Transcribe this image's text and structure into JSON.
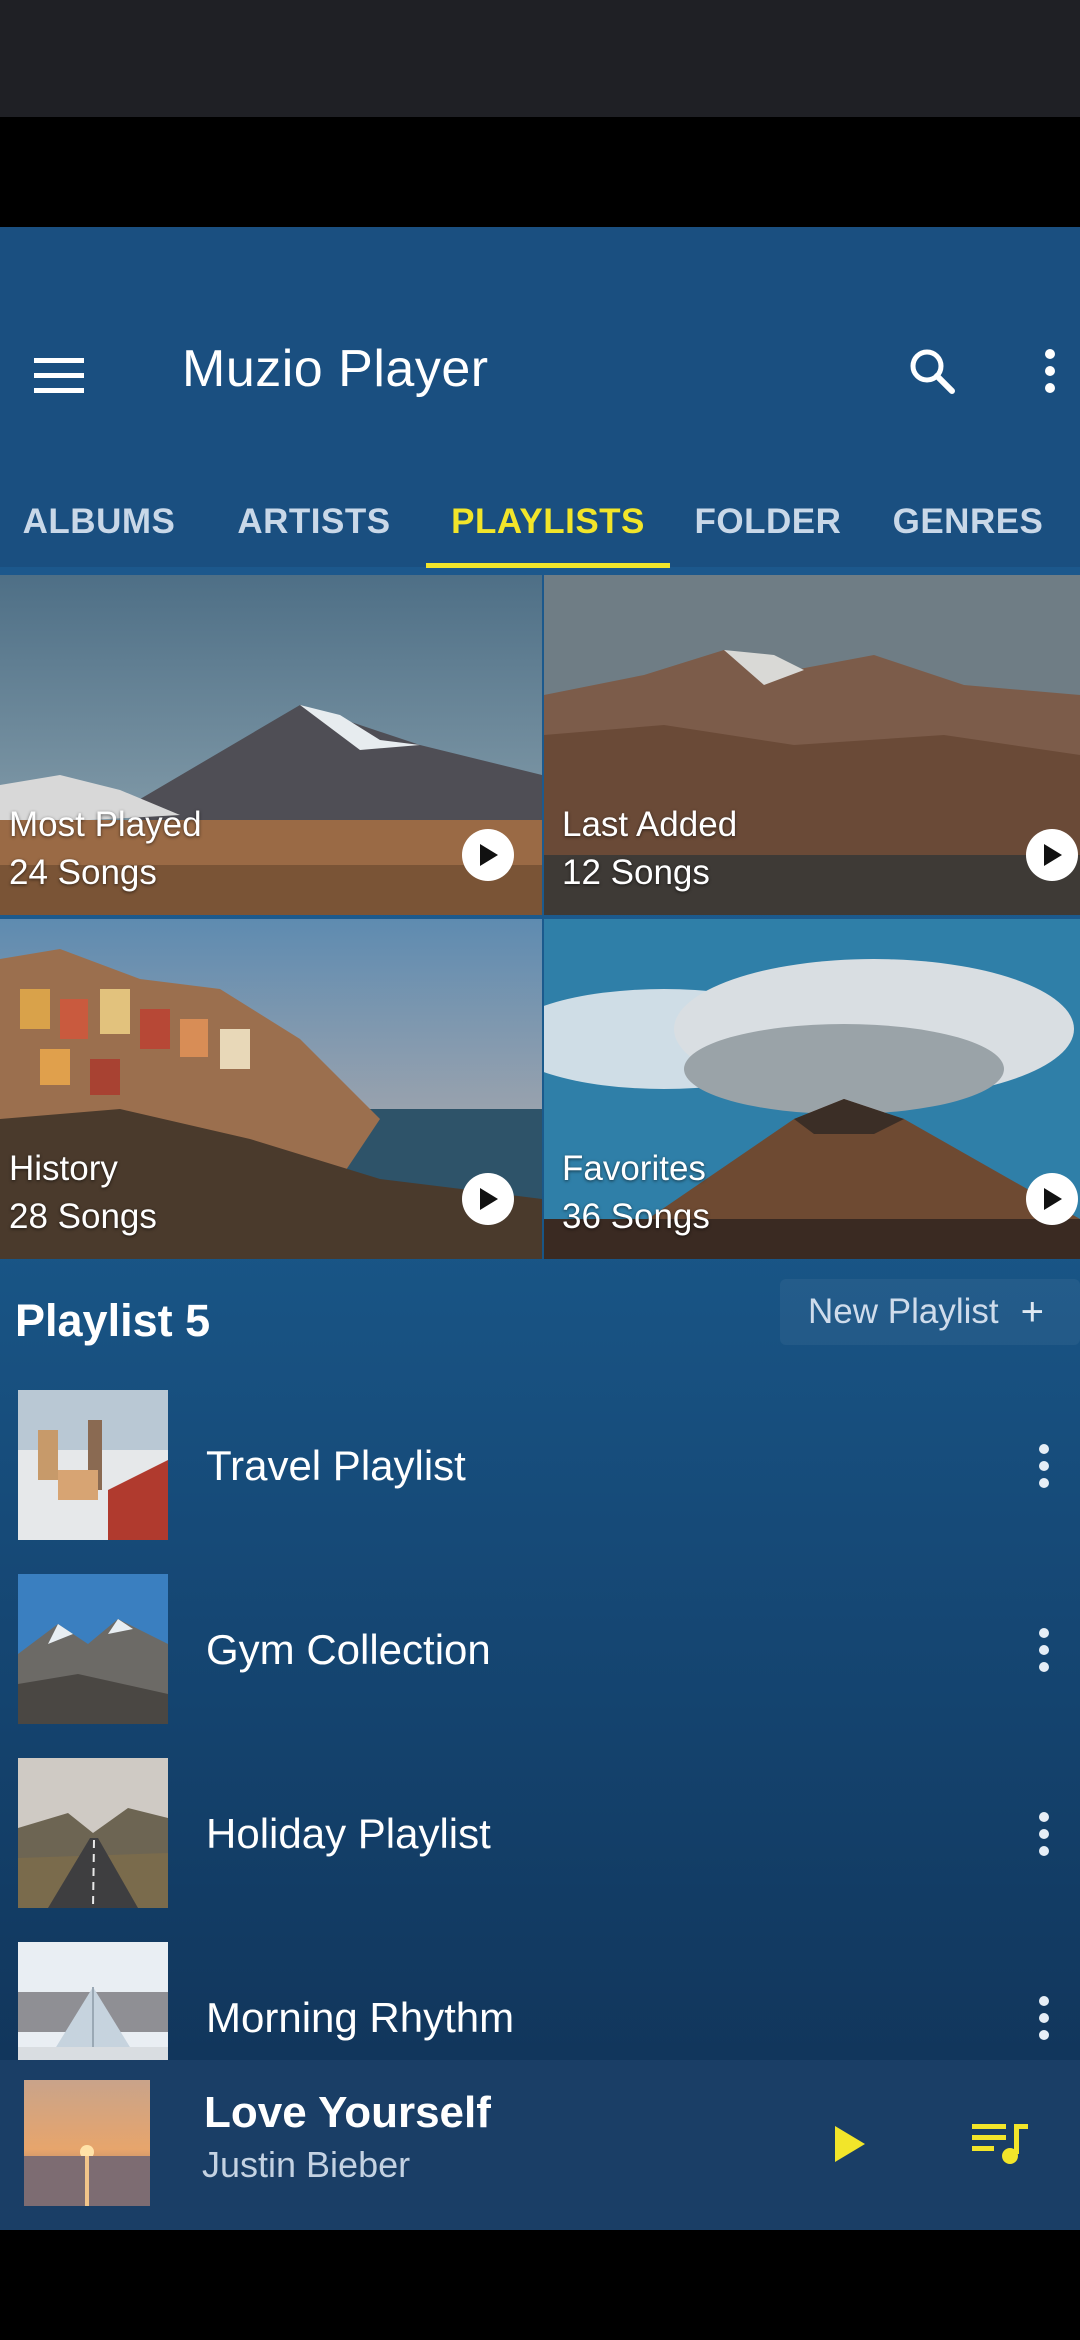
{
  "app": {
    "title": "Muzio Player"
  },
  "tabs": [
    {
      "label": "ALBUMS",
      "active": false
    },
    {
      "label": "ARTISTS",
      "active": false
    },
    {
      "label": "PLAYLISTS",
      "active": true
    },
    {
      "label": "FOLDER",
      "active": false
    },
    {
      "label": "GENRES",
      "active": false
    }
  ],
  "featured": [
    {
      "name": "Most Played",
      "count": "24 Songs"
    },
    {
      "name": "Last Added",
      "count": "12 Songs"
    },
    {
      "name": "History",
      "count": "28 Songs"
    },
    {
      "name": "Favorites",
      "count": "36 Songs"
    }
  ],
  "section": {
    "title": "Playlist 5",
    "new_label": "New Playlist"
  },
  "playlists": [
    {
      "title": "Travel Playlist"
    },
    {
      "title": "Gym Collection"
    },
    {
      "title": "Holiday Playlist"
    },
    {
      "title": "Morning Rhythm"
    }
  ],
  "now_playing": {
    "song": "Love Yourself",
    "artist": "Justin Bieber"
  },
  "colors": {
    "accent": "#f2e52a",
    "appbar": "#1a4f80",
    "background": "#1b5689",
    "mini_player": "#1a3e66"
  }
}
